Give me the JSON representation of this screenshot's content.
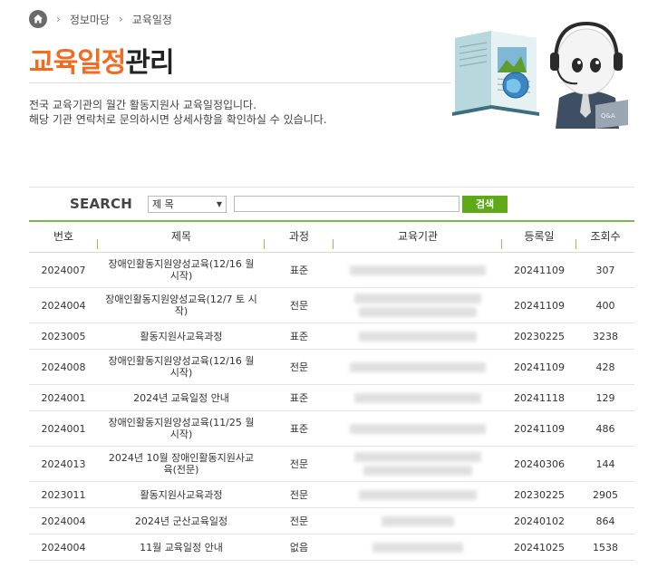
{
  "breadcrumb": {
    "items": [
      "정보마당",
      "교육일정"
    ]
  },
  "title": {
    "accent": "교육일정",
    "rest": "관리"
  },
  "intro": {
    "line1": "전국 교육기관의 월간 활동지원사 교육일정입니다.",
    "line2": "해당 기관 연락처로 문의하시면 상세사항을 확인하실 수 있습니다."
  },
  "search": {
    "label": "SEARCH",
    "select_value": "제 목",
    "button": "검색"
  },
  "table": {
    "headers": [
      "번호",
      "제목",
      "과정",
      "교육기관",
      "등록일",
      "조회수"
    ],
    "rows": [
      {
        "no": "2024007",
        "title": "장애인활동지원양성교육(12/16 월 시작)",
        "course": "표준",
        "date": "20241109",
        "views": "307"
      },
      {
        "no": "2024004",
        "title": "장애인활동지원양성교육(12/7 토 시작)",
        "course": "전문",
        "date": "20241109",
        "views": "400"
      },
      {
        "no": "2023005",
        "title": "활동지원사교육과정",
        "course": "표준",
        "date": "20230225",
        "views": "3238"
      },
      {
        "no": "2024008",
        "title": "장애인활동지원양성교육(12/16 월 시작)",
        "course": "전문",
        "date": "20241109",
        "views": "428"
      },
      {
        "no": "2024001",
        "title": "2024년 교육일정 안내",
        "course": "표준",
        "date": "20241118",
        "views": "129"
      },
      {
        "no": "2024001",
        "title": "장애인활동지원양성교육(11/25 월 시작)",
        "course": "표준",
        "date": "20241109",
        "views": "486"
      },
      {
        "no": "2024013",
        "title": "2024년 10월 장애인활동지원사교육(전문)",
        "course": "전문",
        "date": "20240306",
        "views": "144"
      },
      {
        "no": "2023011",
        "title": "활동지원사교육과정",
        "course": "전문",
        "date": "20230225",
        "views": "2905"
      },
      {
        "no": "2024004",
        "title": "2024년 군산교육일정",
        "course": "전문",
        "date": "20240102",
        "views": "864"
      },
      {
        "no": "2024004",
        "title": "11월 교육일정 안내",
        "course": "없음",
        "date": "20241025",
        "views": "1538"
      }
    ]
  },
  "colors": {
    "accent": "#f26b21",
    "brand_green": "#5fa818",
    "rule_green": "#7dba42"
  }
}
